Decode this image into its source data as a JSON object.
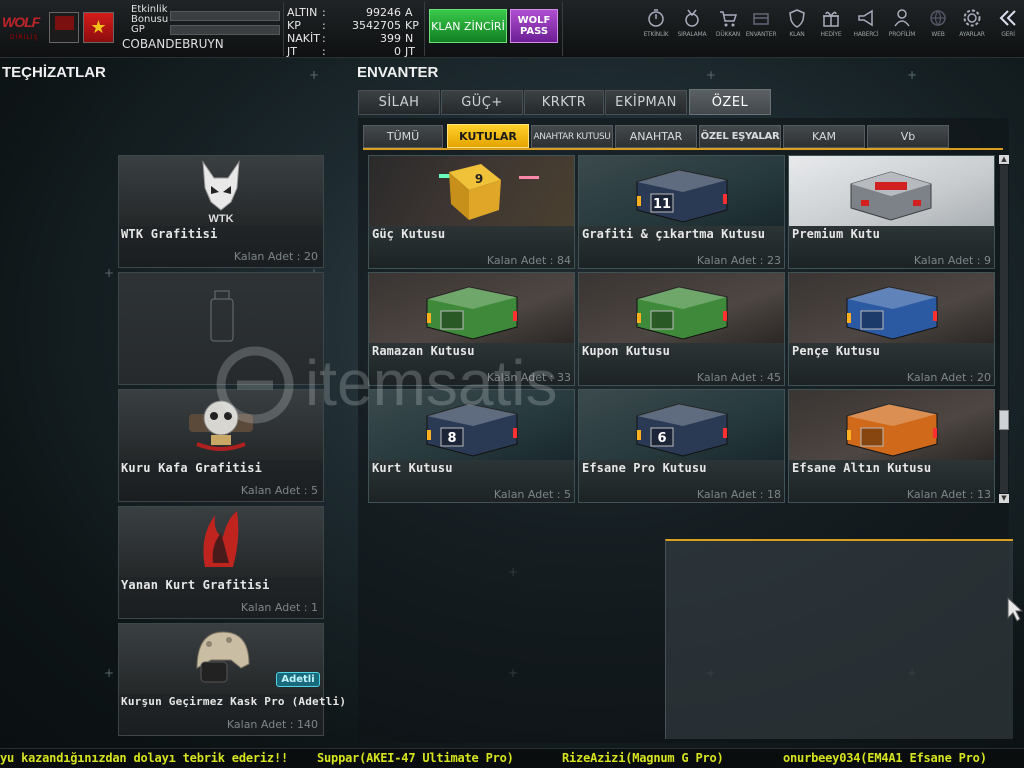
{
  "header": {
    "logo_text": "WOLF",
    "logo_sub": "DİRİLİŞ",
    "etkinlik_label": "Etkinlik\nBonusu",
    "gp_label": "GP",
    "username": "COBANDEBRUYN",
    "currencies": [
      {
        "label": "ALTIN",
        "value": "99246",
        "unit": "A"
      },
      {
        "label": "KP",
        "value": "3542705",
        "unit": "KP"
      },
      {
        "label": "NAKİT",
        "value": "399",
        "unit": "N"
      },
      {
        "label": "JT",
        "value": "0",
        "unit": "JT"
      }
    ],
    "klan_zinciri": "KLAN ZİNCİRİ",
    "wolf_pass": "WOLF PASS",
    "nav": [
      {
        "label": "ETKİNLİK",
        "icon": "timer-icon"
      },
      {
        "label": "SIRALAMA",
        "icon": "medal-icon"
      },
      {
        "label": "DÜKKAN",
        "icon": "cart-icon"
      },
      {
        "label": "ENVANTER",
        "icon": "inventory-icon"
      },
      {
        "label": "KLAN",
        "icon": "shield-icon"
      },
      {
        "label": "HEDİYE",
        "icon": "gift-icon"
      },
      {
        "label": "HABERCİ",
        "icon": "megaphone-icon"
      },
      {
        "label": "PROFİLİM",
        "icon": "profile-icon"
      },
      {
        "label": "WEB",
        "icon": "globe-icon"
      },
      {
        "label": "AYARLAR",
        "icon": "gear-icon"
      },
      {
        "label": "GERİ",
        "icon": "back-icon"
      }
    ]
  },
  "equipment": {
    "title": "TEÇHİZATLAR",
    "items": [
      {
        "name": "WTK Grafitisi",
        "count": "Kalan Adet : 20",
        "icon": "wolf-head-icon",
        "logo_text": "WTK"
      },
      {
        "name": "",
        "count": "",
        "icon": "spray-can-icon"
      },
      {
        "name": "Kuru Kafa Grafitisi",
        "count": "Kalan Adet : 5",
        "icon": "skull-emblem-icon"
      },
      {
        "name": "Yanan Kurt Grafitisi",
        "count": "Kalan Adet : 1",
        "icon": "burning-wolf-icon"
      },
      {
        "name": "Kurşun Geçirmez Kask Pro (Adetli)",
        "count": "Kalan Adet : 140",
        "icon": "helmet-icon",
        "badge": "Adetli"
      }
    ]
  },
  "inventory": {
    "title": "ENVANTER",
    "tabs": [
      "SİLAH",
      "GÜÇ+",
      "KRKTR",
      "EKİPMAN",
      "ÖZEL"
    ],
    "active_tab": "ÖZEL",
    "subtabs": [
      "TÜMÜ",
      "KUTULAR",
      "ANAHTAR KUTUSU",
      "ANAHTAR",
      "ÖZEL EŞYALAR",
      "KAM",
      "Vb"
    ],
    "active_subtab": "KUTULAR",
    "items": [
      {
        "name": "Güç Kutusu",
        "count": "Kalan Adet : 84",
        "icon": "golden-dice-icon",
        "crate_color": "#c79a1a",
        "crate_label": "9"
      },
      {
        "name": "Grafiti & çıkartma Kutusu",
        "count": "Kalan Adet : 23",
        "icon": "crate-icon",
        "crate_color": "#2a3a55",
        "crate_label": "11"
      },
      {
        "name": "Premium Kutu",
        "count": "Kalan Adet : 9",
        "icon": "premium-crate-icon",
        "crate_color": "#8a8f94",
        "crate_label": ""
      },
      {
        "name": "Ramazan Kutusu",
        "count": "Kalan Adet : 33",
        "icon": "crate-icon",
        "crate_color": "#3f8a3a",
        "crate_label": ""
      },
      {
        "name": "Kupon Kutusu",
        "count": "Kalan Adet : 45",
        "icon": "crate-icon",
        "crate_color": "#3f8a3a",
        "crate_label": ""
      },
      {
        "name": "Pençe Kutusu",
        "count": "Kalan Adet : 20",
        "icon": "crate-icon",
        "crate_color": "#2b5aa3",
        "crate_label": ""
      },
      {
        "name": "Kurt Kutusu",
        "count": "Kalan Adet : 5",
        "icon": "crate-icon",
        "crate_color": "#2a3a55",
        "crate_label": "8"
      },
      {
        "name": "Efsane Pro Kutusu",
        "count": "Kalan Adet : 18",
        "icon": "crate-icon",
        "crate_color": "#2a3a55",
        "crate_label": "6"
      },
      {
        "name": "Efsane Altın Kutusu",
        "count": "Kalan Adet : 13",
        "icon": "crate-icon",
        "crate_color": "#d06a1a",
        "crate_label": ""
      }
    ]
  },
  "watermark": "itemsatis",
  "ticker": [
    "yu kazandığınızdan dolayı tebrik ederiz!!",
    "Suppar(AKEI-47 Ultimate Pro)",
    "RizeAzizi(Magnum G Pro)",
    "onurbeey034(EM4A1 Efsane Pro)"
  ],
  "colors": {
    "accent": "#ffcc22",
    "ticker": "#d6e31f",
    "klan": "#22a838",
    "wolfpass": "#9a3cc0"
  }
}
